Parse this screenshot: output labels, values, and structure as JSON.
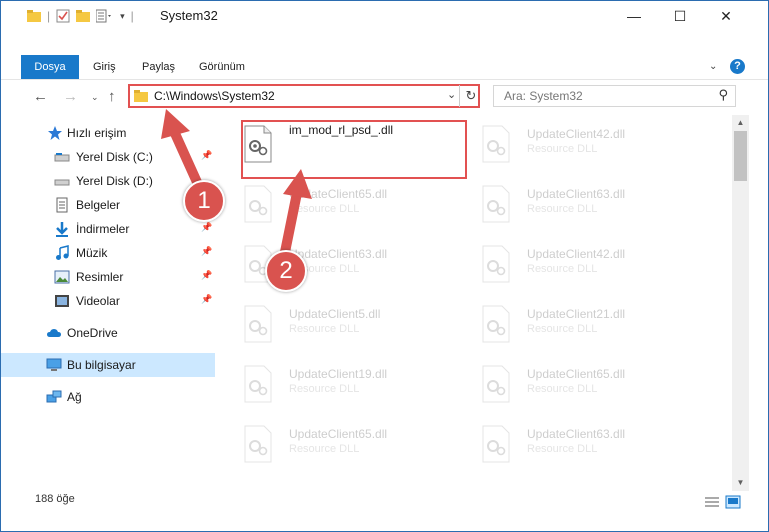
{
  "window": {
    "title": "System32",
    "controls": {
      "minimize": "—",
      "maximize": "☐",
      "close": "✕"
    }
  },
  "ribbon": {
    "tabs": [
      "Dosya",
      "Giriş",
      "Paylaş",
      "Görünüm"
    ],
    "help": "?"
  },
  "address": {
    "path": "C:\\Windows\\System32",
    "search_placeholder": "Ara: System32"
  },
  "nav": {
    "items": [
      {
        "label": "Hızlı erişim",
        "icon": "star-icon"
      },
      {
        "label": "Yerel Disk (C:)",
        "icon": "drive-icon"
      },
      {
        "label": "Yerel Disk (D:)",
        "icon": "drive-icon"
      },
      {
        "label": "Belgeler",
        "icon": "documents-icon"
      },
      {
        "label": "İndirmeler",
        "icon": "download-icon"
      },
      {
        "label": "Müzik",
        "icon": "music-icon"
      },
      {
        "label": "Resimler",
        "icon": "pictures-icon"
      },
      {
        "label": "Videolar",
        "icon": "video-icon"
      },
      {
        "label": "OneDrive",
        "icon": "cloud-icon"
      },
      {
        "label": "Bu bilgisayar",
        "icon": "computer-icon"
      },
      {
        "label": "Ağ",
        "icon": "network-icon"
      }
    ],
    "selected": "Bu bilgisayar"
  },
  "files": {
    "highlighted": {
      "name": "im_mod_rl_psd_.dll"
    },
    "faded": [
      {
        "name": "UpdateClient42.dll",
        "type": "Resource DLL"
      },
      {
        "name": "UpdateClient65.dll",
        "type": "Resource DLL"
      },
      {
        "name": "UpdateClient63.dll",
        "type": "Resource DLL"
      },
      {
        "name": "UpdateClient63.dll",
        "type": "Resource DLL"
      },
      {
        "name": "UpdateClient42.dll",
        "type": "Resource DLL"
      },
      {
        "name": "UpdateClient5.dll",
        "type": "Resource DLL"
      },
      {
        "name": "UpdateClient21.dll",
        "type": "Resource DLL"
      },
      {
        "name": "UpdateClient19.dll",
        "type": "Resource DLL"
      },
      {
        "name": "UpdateClient65.dll",
        "type": "Resource DLL"
      },
      {
        "name": "UpdateClient65.dll",
        "type": "Resource DLL"
      },
      {
        "name": "UpdateClient63.dll",
        "type": "Resource DLL"
      }
    ]
  },
  "status": {
    "count": "188 öğe"
  },
  "annotations": {
    "step1": "1",
    "step2": "2"
  },
  "colors": {
    "accent": "#1979ca",
    "annotation": "#d9534f",
    "highlight_border": "#e25151"
  }
}
